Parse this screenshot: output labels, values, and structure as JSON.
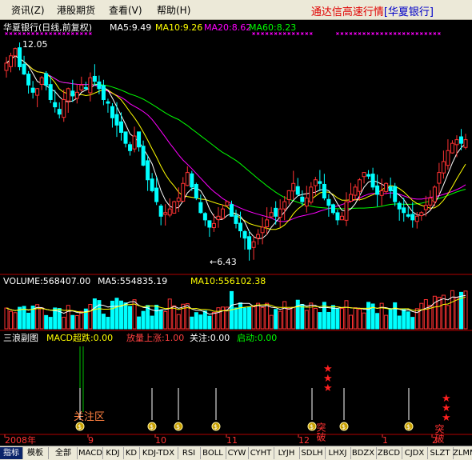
{
  "menu": {
    "items": [
      "资讯(Z)",
      "港股期货",
      "查看(V)",
      "帮助(H)"
    ],
    "app_title": "通达信高速行情",
    "stock_name_bracket": "[华夏银行]"
  },
  "main_panel": {
    "header": "华夏银行(日线,前复权)",
    "ma5": "MA5:9.49",
    "ma10": "MA10:9.26",
    "ma20": "MA20:8.62",
    "ma60": "MA60:8.23",
    "high_label": "12.05",
    "low_label": "←6.43",
    "colors": {
      "ma5": "#ffffff",
      "ma10": "#ffff00",
      "ma20": "#ff00ff",
      "ma60": "#00ff00",
      "up": "#ff3232",
      "down": "#00ffff"
    }
  },
  "volume_panel": {
    "label": "VOLUME:568407.00",
    "ma5": "MA5:554835.19",
    "ma10": "MA10:556102.38"
  },
  "indicator_panel": {
    "name": "三浪副图",
    "macd": "MACD超跌:0.00",
    "vol_up": "放量上涨:1.00",
    "watch": "关注:0.00",
    "start": "启动:0.00",
    "zone_label": "关注区",
    "breakout_label": "突破"
  },
  "time_axis": {
    "labels": [
      "2008年",
      "9",
      "10",
      "11",
      "12",
      "1",
      "2"
    ]
  },
  "chart_data": {
    "type": "candlestick",
    "symbol": "华夏银行",
    "period": "日线,前复权",
    "price_high": 12.05,
    "price_low": 6.43,
    "close_approx": [
      11.6,
      11.8,
      12.0,
      11.5,
      11.3,
      11.0,
      10.8,
      10.9,
      11.2,
      11.0,
      10.6,
      10.4,
      10.2,
      10.6,
      10.9,
      10.7,
      10.8,
      11.0,
      10.9,
      11.2,
      11.1,
      10.9,
      10.6,
      10.5,
      10.1,
      9.9,
      9.7,
      9.4,
      9.2,
      9.6,
      9.3,
      8.8,
      8.4,
      8.1,
      7.8,
      7.4,
      7.5,
      7.6,
      7.8,
      7.9,
      8.3,
      8.6,
      8.2,
      7.9,
      7.5,
      7.3,
      7.1,
      7.2,
      7.4,
      7.6,
      7.8,
      7.4,
      7.2,
      7.0,
      6.8,
      6.5,
      6.7,
      6.9,
      7.1,
      7.3,
      7.5,
      7.4,
      7.6,
      7.8,
      8.1,
      8.3,
      8.0,
      7.8,
      7.9,
      8.2,
      8.4,
      8.3,
      7.9,
      7.7,
      7.5,
      7.3,
      7.4,
      7.8,
      8.0,
      8.2,
      8.4,
      8.6,
      8.5,
      8.2,
      8.0,
      8.1,
      8.3,
      8.1,
      7.8,
      7.6,
      7.5,
      7.4,
      7.3,
      7.4,
      7.5,
      7.7,
      7.9,
      8.2,
      8.6,
      8.9,
      9.2,
      9.4,
      9.5,
      9.4,
      9.5
    ]
  }
}
